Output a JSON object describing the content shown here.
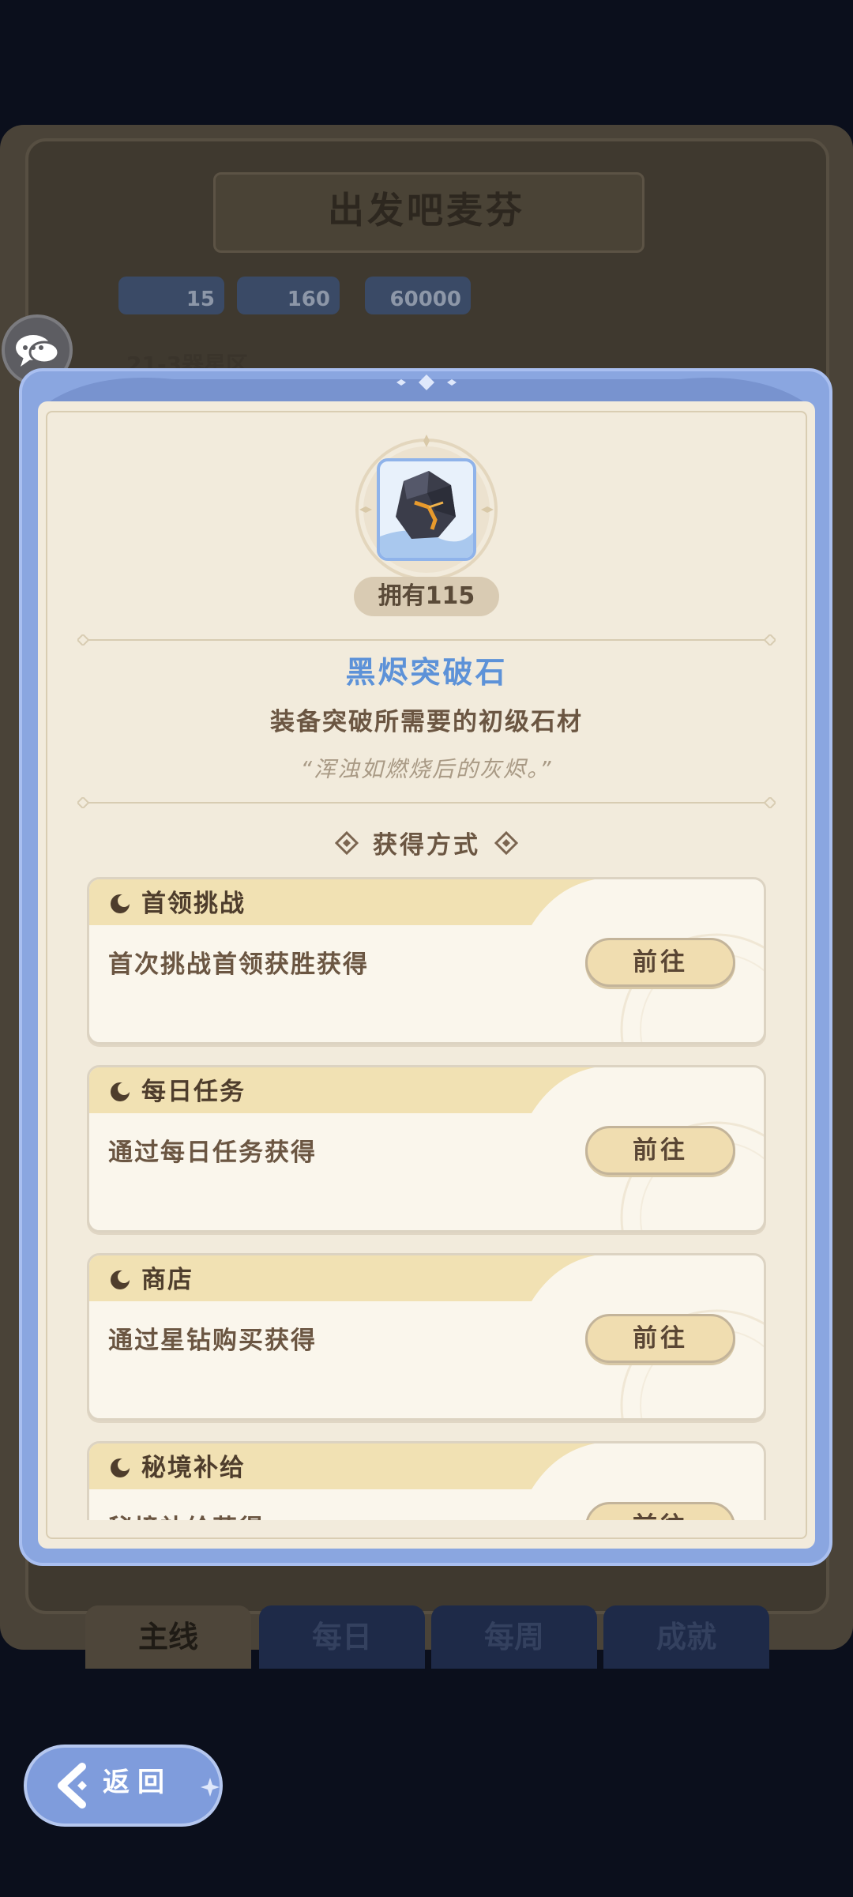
{
  "background": {
    "book_title": "出发吧麦芬",
    "rewards": [
      "15",
      "160",
      "60000"
    ],
    "stage_label": "21-3器星区",
    "tabs": [
      {
        "label": "主线",
        "active": true
      },
      {
        "label": "每日",
        "active": false
      },
      {
        "label": "每周",
        "active": false
      },
      {
        "label": "成就",
        "active": false
      }
    ]
  },
  "item": {
    "owned": "拥有115",
    "name": "黑烬突破石",
    "description": "装备突破所需要的初级石材",
    "quote": "“浑浊如燃烧后的灰烬。”",
    "icon": "black-ember-stone-icon"
  },
  "sources_title": "获得方式",
  "sources": [
    {
      "title": "首领挑战",
      "text": "首次挑战首领获胜获得",
      "button": "前往"
    },
    {
      "title": "每日任务",
      "text": "通过每日任务获得",
      "button": "前往"
    },
    {
      "title": "商店",
      "text": "通过星钻购买获得",
      "button": "前往"
    },
    {
      "title": "秘境补给",
      "text": "秘境补给获得",
      "button": "前往"
    }
  ],
  "back_label": "返回",
  "colors": {
    "accent_blue": "#5d92d8",
    "frame_blue": "#8aa6e0",
    "paper": "#f2ebdc",
    "button": "#f0ddb0"
  }
}
